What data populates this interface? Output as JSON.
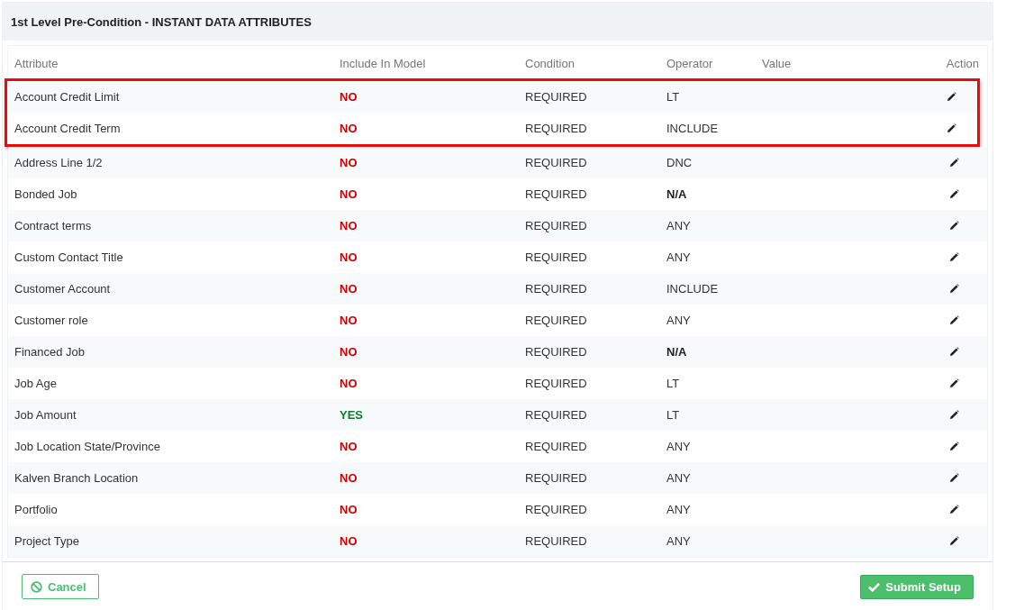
{
  "panel": {
    "title": "1st Level Pre-Condition - INSTANT DATA ATTRIBUTES"
  },
  "table": {
    "columns": [
      "Attribute",
      "Include In Model",
      "Condition",
      "Operator",
      "Value",
      "Action"
    ],
    "rows": [
      {
        "attribute": "Account Credit Limit",
        "include": "NO",
        "included": false,
        "condition": "REQUIRED",
        "operator": "LT",
        "operator_bold": false,
        "highlighted": true
      },
      {
        "attribute": "Account Credit Term",
        "include": "NO",
        "included": false,
        "condition": "REQUIRED",
        "operator": "INCLUDE",
        "operator_bold": false,
        "highlighted": true
      },
      {
        "attribute": "Address Line 1/2",
        "include": "NO",
        "included": false,
        "condition": "REQUIRED",
        "operator": "DNC",
        "operator_bold": false,
        "highlighted": false
      },
      {
        "attribute": "Bonded Job",
        "include": "NO",
        "included": false,
        "condition": "REQUIRED",
        "operator": "N/A",
        "operator_bold": true,
        "highlighted": false
      },
      {
        "attribute": "Contract terms",
        "include": "NO",
        "included": false,
        "condition": "REQUIRED",
        "operator": "ANY",
        "operator_bold": false,
        "highlighted": false
      },
      {
        "attribute": "Custom Contact Title",
        "include": "NO",
        "included": false,
        "condition": "REQUIRED",
        "operator": "ANY",
        "operator_bold": false,
        "highlighted": false
      },
      {
        "attribute": "Customer Account",
        "include": "NO",
        "included": false,
        "condition": "REQUIRED",
        "operator": "INCLUDE",
        "operator_bold": false,
        "highlighted": false
      },
      {
        "attribute": "Customer role",
        "include": "NO",
        "included": false,
        "condition": "REQUIRED",
        "operator": "ANY",
        "operator_bold": false,
        "highlighted": false
      },
      {
        "attribute": "Financed Job",
        "include": "NO",
        "included": false,
        "condition": "REQUIRED",
        "operator": "N/A",
        "operator_bold": true,
        "highlighted": false
      },
      {
        "attribute": "Job Age",
        "include": "NO",
        "included": false,
        "condition": "REQUIRED",
        "operator": "LT",
        "operator_bold": false,
        "highlighted": false
      },
      {
        "attribute": "Job Amount",
        "include": "YES",
        "included": true,
        "condition": "REQUIRED",
        "operator": "LT",
        "operator_bold": false,
        "highlighted": false
      },
      {
        "attribute": "Job Location State/Province",
        "include": "NO",
        "included": false,
        "condition": "REQUIRED",
        "operator": "ANY",
        "operator_bold": false,
        "highlighted": false
      },
      {
        "attribute": "Kalven Branch Location",
        "include": "NO",
        "included": false,
        "condition": "REQUIRED",
        "operator": "ANY",
        "operator_bold": false,
        "highlighted": false
      },
      {
        "attribute": "Portfolio",
        "include": "NO",
        "included": false,
        "condition": "REQUIRED",
        "operator": "ANY",
        "operator_bold": false,
        "highlighted": false
      },
      {
        "attribute": "Project Type",
        "include": "NO",
        "included": false,
        "condition": "REQUIRED",
        "operator": "ANY",
        "operator_bold": false,
        "highlighted": false
      }
    ]
  },
  "buttons": {
    "cancel": "Cancel",
    "submit": "Submit Setup"
  }
}
